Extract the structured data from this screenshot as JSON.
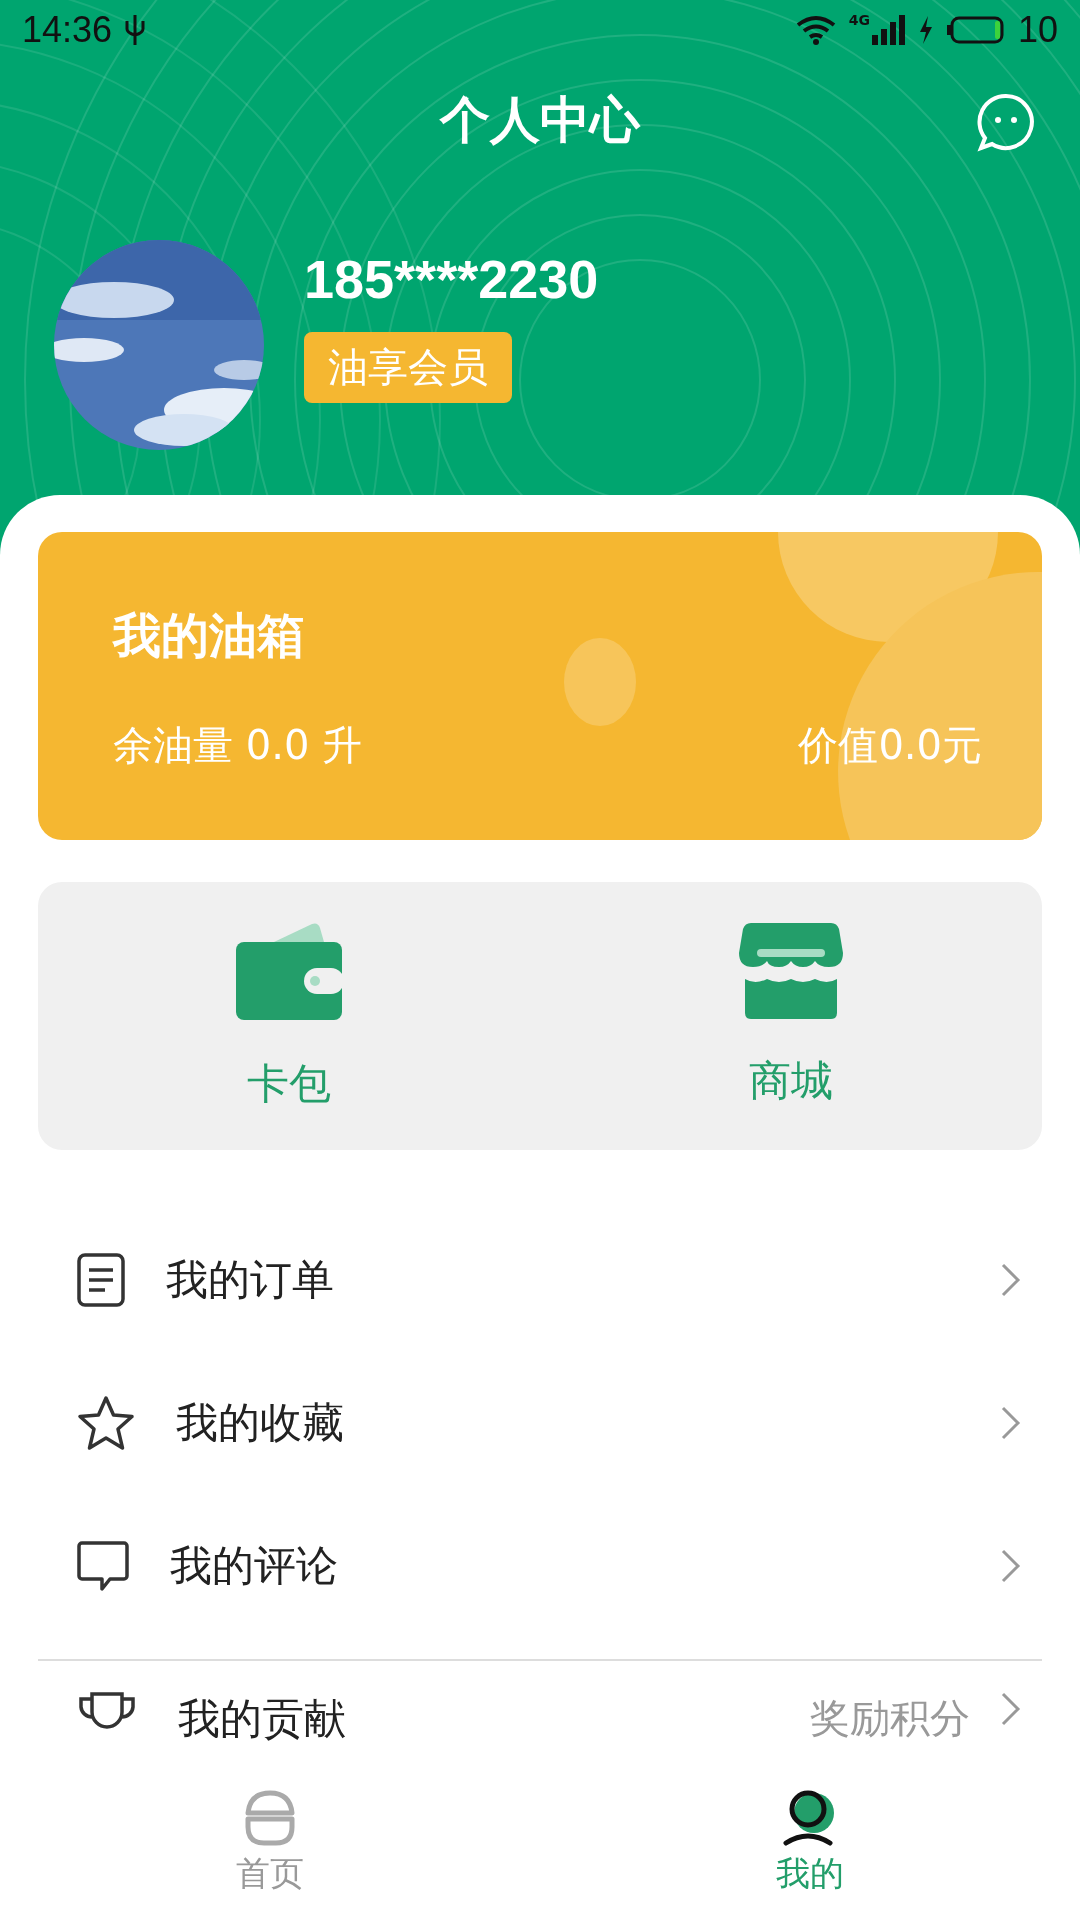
{
  "status_bar": {
    "time": "14:36",
    "network": "4G",
    "battery": "10"
  },
  "header": {
    "title": "个人中心"
  },
  "profile": {
    "phone": "185****2230",
    "badge": "油享会员"
  },
  "tank": {
    "title": "我的油箱",
    "remaining": "余油量 0.0 升",
    "value": "价值0.0元"
  },
  "shortcuts": [
    {
      "label": "卡包"
    },
    {
      "label": "商城"
    }
  ],
  "menu": [
    {
      "label": "我的订单"
    },
    {
      "label": "我的收藏"
    },
    {
      "label": "我的评论"
    }
  ],
  "menu_2": [
    {
      "label": "我的贡献",
      "value": "奖励积分"
    }
  ],
  "tabs": [
    {
      "label": "首页",
      "selected": false
    },
    {
      "label": "我的",
      "selected": true
    }
  ]
}
